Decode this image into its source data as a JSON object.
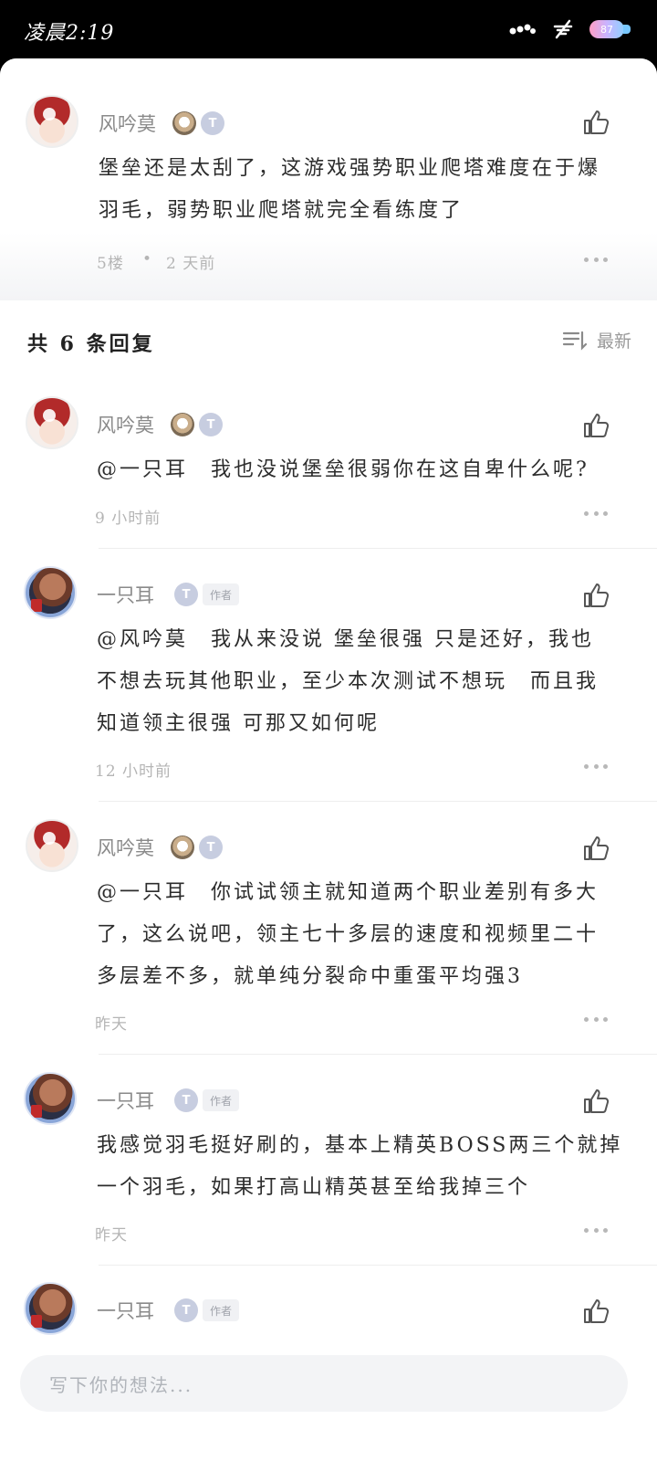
{
  "status": {
    "time": "凌晨2:19",
    "battery": "87"
  },
  "main_comment": {
    "username": "风吟莫",
    "level_badge": "T",
    "text_line1": "堡垒还是太刮了，这游戏强势职业爬塔难度在于爆",
    "text_line2": "羽毛，弱势职业爬塔就完全看练度了",
    "floor": "5楼",
    "separator": "•",
    "time": "2 天前"
  },
  "replies_header": {
    "count_label": "共 6 条回复",
    "sort_label": "最新"
  },
  "replies": [
    {
      "username": "风吟莫",
      "level_badge": "T",
      "lines": [
        "@一只耳　我也没说堡垒很弱你在这自卑什么呢?"
      ],
      "time": "9 小时前"
    },
    {
      "username": "一只耳",
      "level_badge": "T",
      "author_tag": "作者",
      "lines": [
        "@风吟莫　我从来没说 堡垒很强 只是还好，我也",
        "不想去玩其他职业，至少本次测试不想玩　而且我",
        "知道领主很强 可那又如何呢"
      ],
      "time": "12 小时前"
    },
    {
      "username": "风吟莫",
      "level_badge": "T",
      "lines": [
        "@一只耳　你试试领主就知道两个职业差别有多大",
        "了，这么说吧，领主七十多层的速度和视频里二十",
        "多层差不多，就单纯分裂命中重蛋平均强3"
      ],
      "time": "昨天"
    },
    {
      "username": "一只耳",
      "level_badge": "T",
      "author_tag": "作者",
      "lines": [
        "我感觉羽毛挺好刷的，基本上精英BOSS两三个就掉",
        "一个羽毛，如果打高山精英甚至给我掉三个"
      ],
      "time": "昨天"
    },
    {
      "username": "一只耳",
      "level_badge": "T",
      "author_tag": "作者"
    }
  ],
  "input": {
    "placeholder": "写下你的想法..."
  },
  "icons": {
    "like": "thumbs-up-icon",
    "more": "more-dots-icon",
    "sort": "sort-lines-icon"
  },
  "colors": {
    "accent_text": "#2c2c2c",
    "muted": "#b5b5b5",
    "input_bg": "#f3f4f6"
  }
}
